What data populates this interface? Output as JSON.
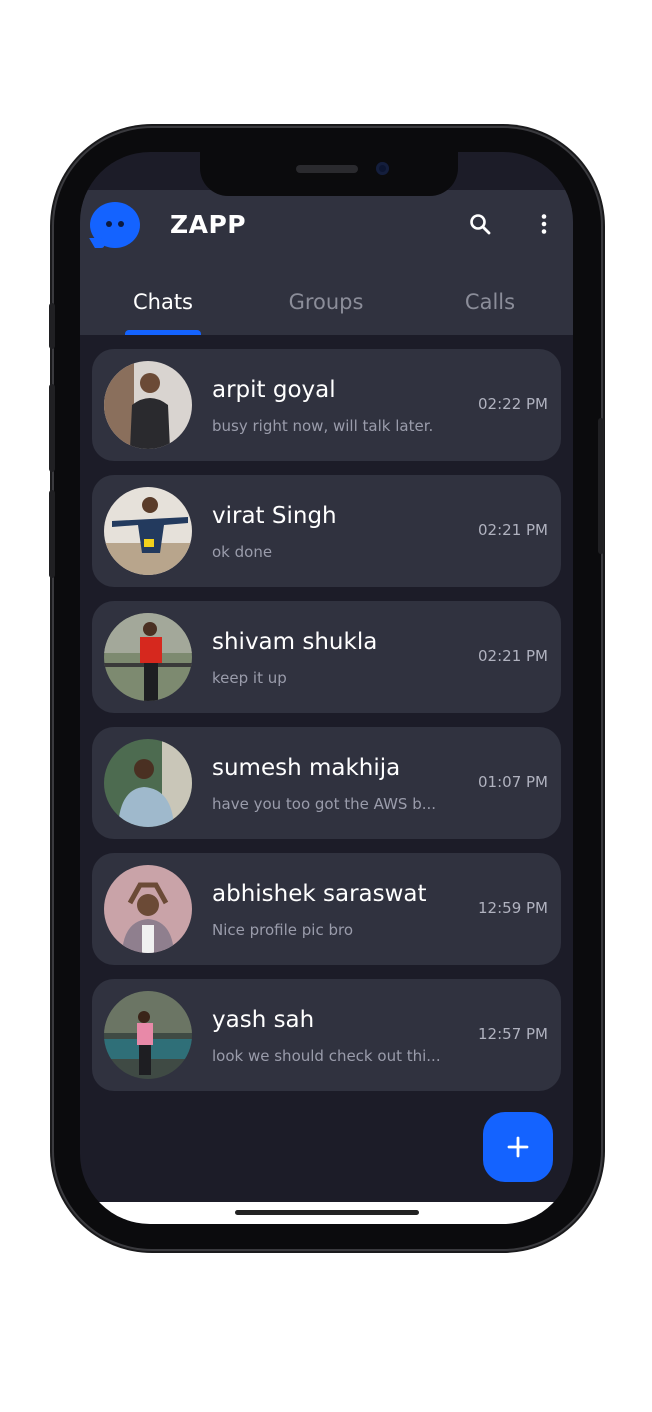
{
  "app": {
    "title": "ZAPP",
    "accent_color": "#1463ff",
    "header_color": "#30323f",
    "background_color": "#1c1c28"
  },
  "header": {
    "search_icon": "search-icon",
    "menu_icon": "more-vertical-icon"
  },
  "tabs": [
    {
      "label": "Chats",
      "active": true
    },
    {
      "label": "Groups",
      "active": false
    },
    {
      "label": "Calls",
      "active": false
    }
  ],
  "chats": [
    {
      "name": "arpit goyal",
      "message": "busy right now, will talk later.",
      "time": "02:22 PM"
    },
    {
      "name": "virat Singh",
      "message": "ok done",
      "time": "02:21 PM"
    },
    {
      "name": "shivam shukla",
      "message": "keep it up",
      "time": "02:21 PM"
    },
    {
      "name": "sumesh makhija",
      "message": "have you too got the AWS b...",
      "time": "01:07 PM"
    },
    {
      "name": "abhishek saraswat",
      "message": "Nice profile pic bro",
      "time": "12:59 PM"
    },
    {
      "name": "yash sah",
      "message": "look we should check out thi...",
      "time": "12:57 PM"
    }
  ],
  "fab": {
    "icon": "plus-icon"
  }
}
